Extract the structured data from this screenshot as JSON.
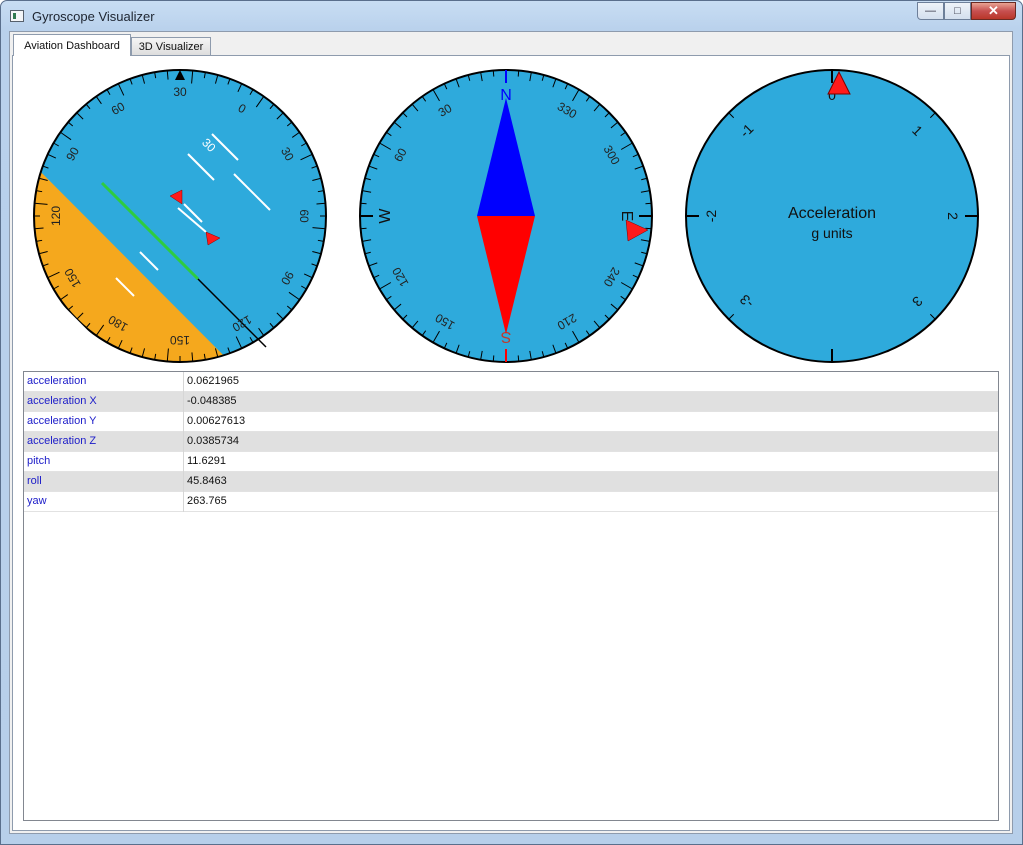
{
  "window": {
    "title": "Gyroscope Visualizer"
  },
  "tabs": [
    {
      "label": "Aviation Dashboard",
      "active": true
    },
    {
      "label": "3D Visualizer",
      "active": false
    }
  ],
  "attitude_indicator": {
    "sky_color": "#2eaadc",
    "ground_color": "#f5a81d",
    "horizon_color": "#2ecc40",
    "pitch_deg": 11.6291,
    "roll_deg": 45.8463,
    "pitch_scale_label": "30",
    "roll_scale_labels": [
      "60",
      "30",
      "0",
      "30",
      "60",
      "90",
      "120",
      "150",
      "180",
      "150",
      "120",
      "90"
    ]
  },
  "heading_indicator": {
    "face_color": "#2eaadc",
    "needle_north_color": "#0000ff",
    "needle_south_color": "#ff0000",
    "heading_deg": 263.765,
    "cardinal_labels": [
      "N",
      "E",
      "S",
      "W"
    ],
    "degree_labels": [
      "30",
      "60",
      "120",
      "150",
      "210",
      "240",
      "300",
      "330"
    ]
  },
  "acceleration_gauge": {
    "face_color": "#2eaadc",
    "title_line1": "Acceleration",
    "title_line2": "g units",
    "value_g": 0.0621965,
    "scale_labels": [
      "0",
      "1",
      "2",
      "3",
      "-3",
      "-2",
      "-1"
    ]
  },
  "properties": [
    {
      "name": "acceleration",
      "value": "0.0621965"
    },
    {
      "name": "acceleration X",
      "value": "-0.048385"
    },
    {
      "name": "acceleration Y",
      "value": "0.00627613"
    },
    {
      "name": "acceleration Z",
      "value": "0.0385734"
    },
    {
      "name": "pitch",
      "value": "11.6291"
    },
    {
      "name": "roll",
      "value": "45.8463"
    },
    {
      "name": "yaw",
      "value": "263.765"
    }
  ]
}
